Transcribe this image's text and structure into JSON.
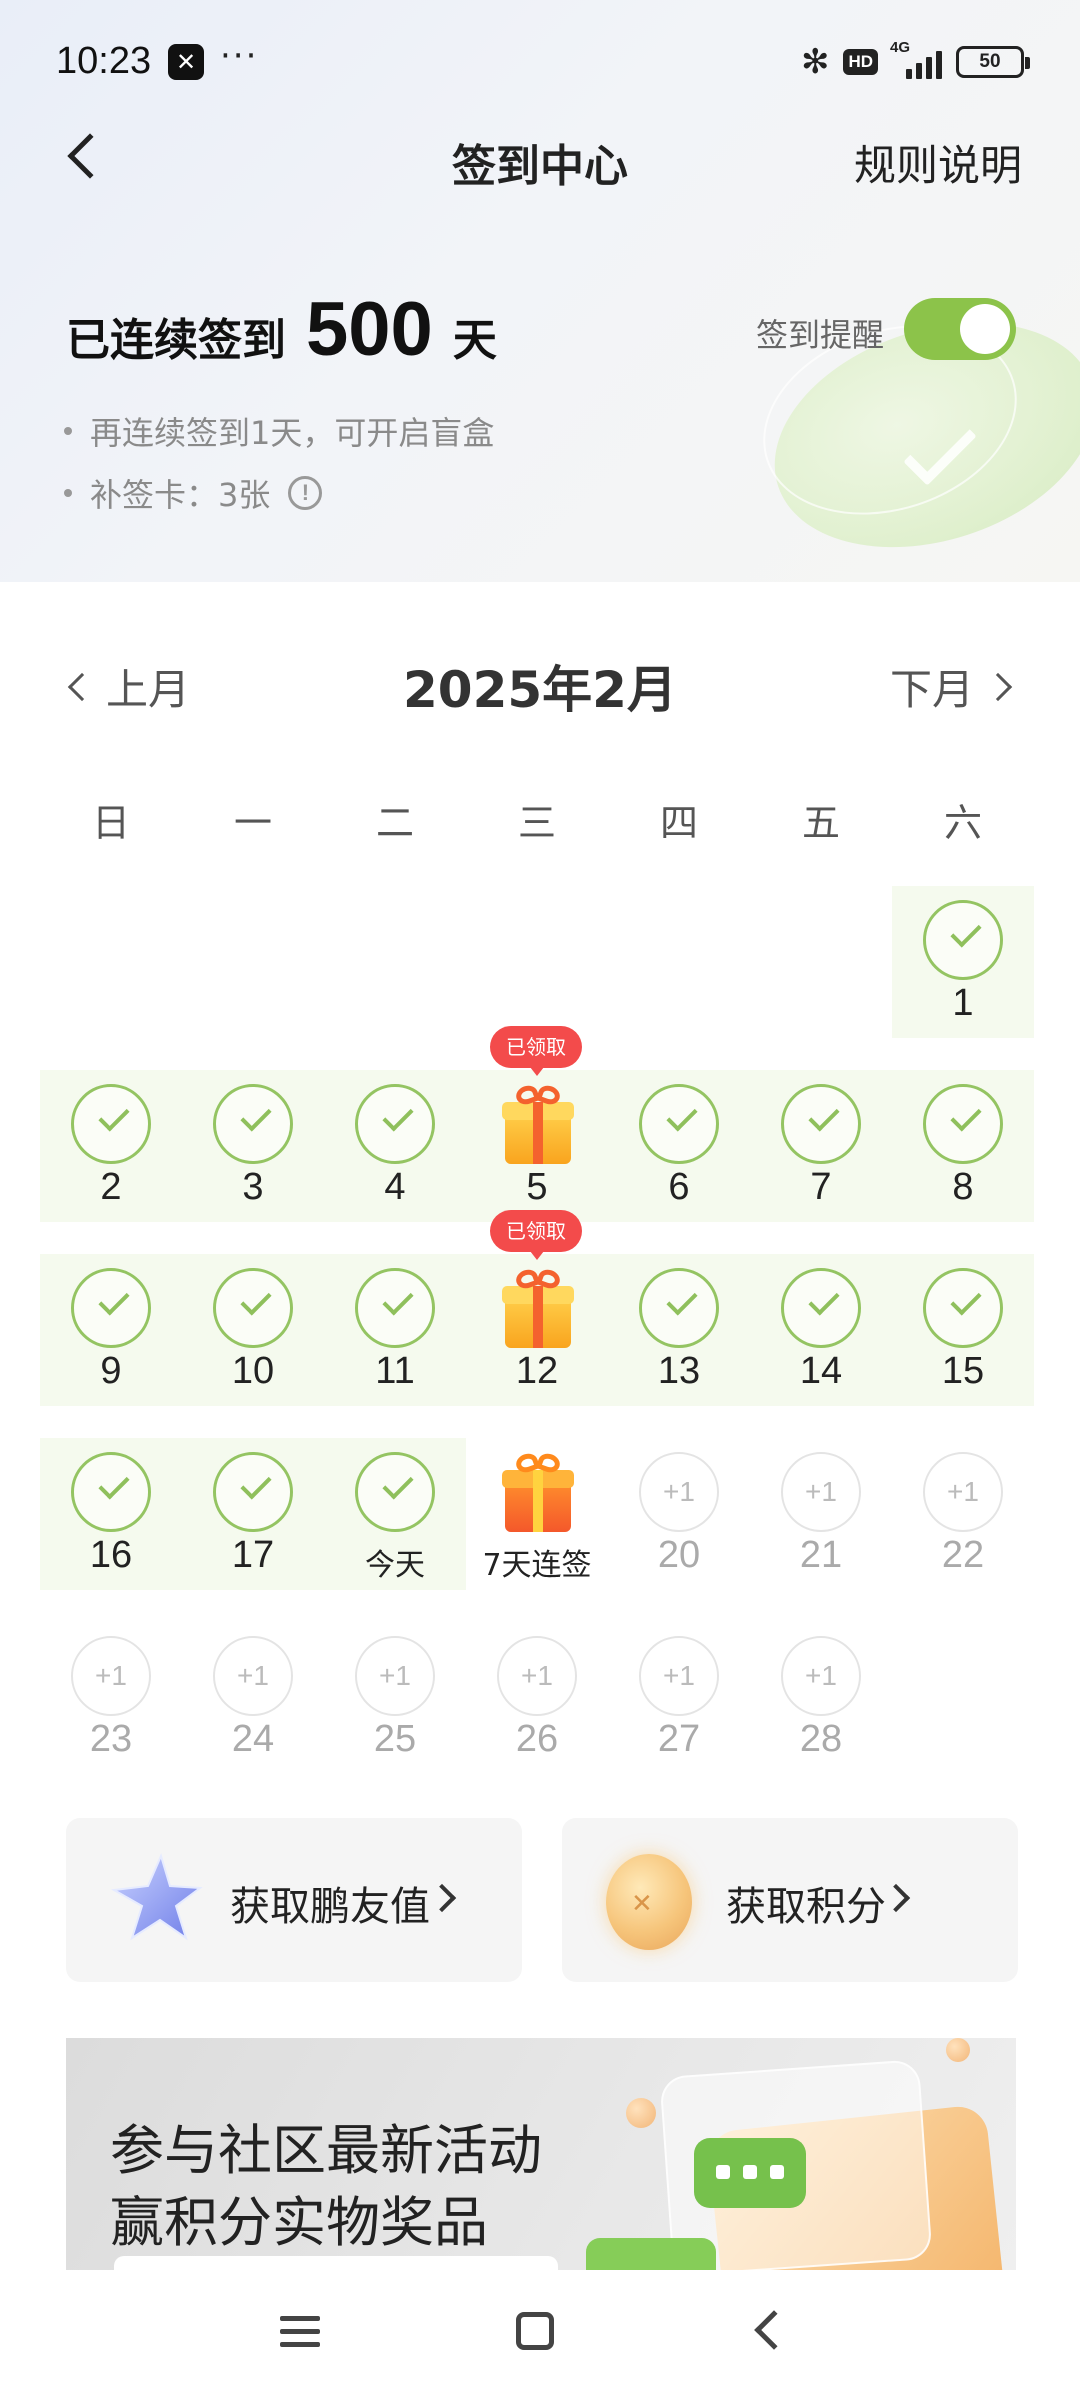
{
  "status_bar": {
    "time": "10:23",
    "dots": "···",
    "network": "4G",
    "hd": "HD",
    "battery": "50"
  },
  "nav": {
    "title": "签到中心",
    "rules": "规则说明"
  },
  "streak": {
    "prefix": "已连续签到",
    "days": "500",
    "suffix": "天",
    "remind_label": "签到提醒",
    "remind_on": true,
    "info1": "再连续签到1天，可开启盲盒",
    "info2": "补签卡：3张"
  },
  "calendar": {
    "prev": "上月",
    "month": "2025年2月",
    "next": "下月",
    "weekdays": [
      "日",
      "一",
      "二",
      "三",
      "四",
      "五",
      "六"
    ],
    "claimed_tag": "已领取",
    "plus_label": "+1",
    "today_label": "今天",
    "bonus_label": "7天连签",
    "days": {
      "d1": "1",
      "d2": "2",
      "d3": "3",
      "d4": "4",
      "d5": "5",
      "d6": "6",
      "d7": "7",
      "d8": "8",
      "d9": "9",
      "d10": "10",
      "d11": "11",
      "d12": "12",
      "d13": "13",
      "d14": "14",
      "d15": "15",
      "d16": "16",
      "d17": "17",
      "d20": "20",
      "d21": "21",
      "d22": "22",
      "d23": "23",
      "d24": "24",
      "d25": "25",
      "d26": "26",
      "d27": "27",
      "d28": "28"
    },
    "accent": "#8cc34a"
  },
  "actions": {
    "friend_value": "获取鹏友值",
    "points": "获取积分"
  },
  "banner": {
    "line1": "参与社区最新活动",
    "line2": "赢积分实物奖品"
  }
}
